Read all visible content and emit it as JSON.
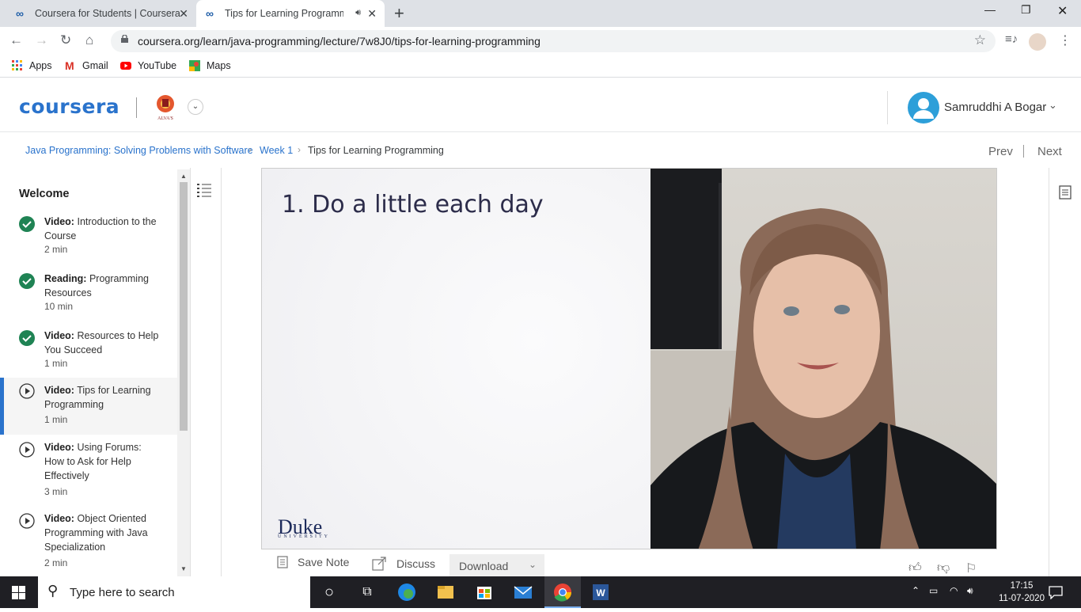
{
  "browser": {
    "tabs": [
      {
        "title": "Coursera for Students | Coursera",
        "active": false
      },
      {
        "title": "Tips for Learning Programmi",
        "active": true
      }
    ],
    "url": "coursera.org/learn/java-programming/lecture/7w8J0/tips-for-learning-programming",
    "bookmarks": [
      "Apps",
      "Gmail",
      "YouTube",
      "Maps"
    ]
  },
  "header": {
    "logo": "coursera",
    "org": "ALVA'S",
    "user_name": "Samruddhi A Bogar"
  },
  "breadcrumb": {
    "course": "Java Programming: Solving Problems with Software",
    "week": "Week 1",
    "current": "Tips for Learning Programming",
    "prev": "Prev",
    "next": "Next"
  },
  "sidebar": {
    "title": "Welcome",
    "items": [
      {
        "kind": "Video:",
        "title": "Introduction to the Course",
        "duration": "2 min",
        "status": "completed"
      },
      {
        "kind": "Reading:",
        "title": "Programming Resources",
        "duration": "10 min",
        "status": "completed"
      },
      {
        "kind": "Video:",
        "title": "Resources to Help You Succeed",
        "duration": "1 min",
        "status": "completed"
      },
      {
        "kind": "Video:",
        "title": "Tips for Learning Programming",
        "duration": "1 min",
        "status": "current"
      },
      {
        "kind": "Video:",
        "title": "Using Forums: How to Ask for Help Effectively",
        "duration": "3 min",
        "status": "not-started"
      },
      {
        "kind": "Video:",
        "title": "Object Oriented Programming with Java Specialization",
        "duration": "2 min",
        "status": "not-started"
      }
    ]
  },
  "video": {
    "slide_title": "1. Do a little each day",
    "brand": "Duke",
    "brand_sub": "UNIVERSITY"
  },
  "actions": {
    "save_note": "Save Note",
    "discuss": "Discuss",
    "download": "Download"
  },
  "taskbar": {
    "search_placeholder": "Type here to search",
    "time": "17:15",
    "date": "11-07-2020"
  },
  "colors": {
    "accent": "#2a73cc",
    "completed": "#1f8354"
  }
}
